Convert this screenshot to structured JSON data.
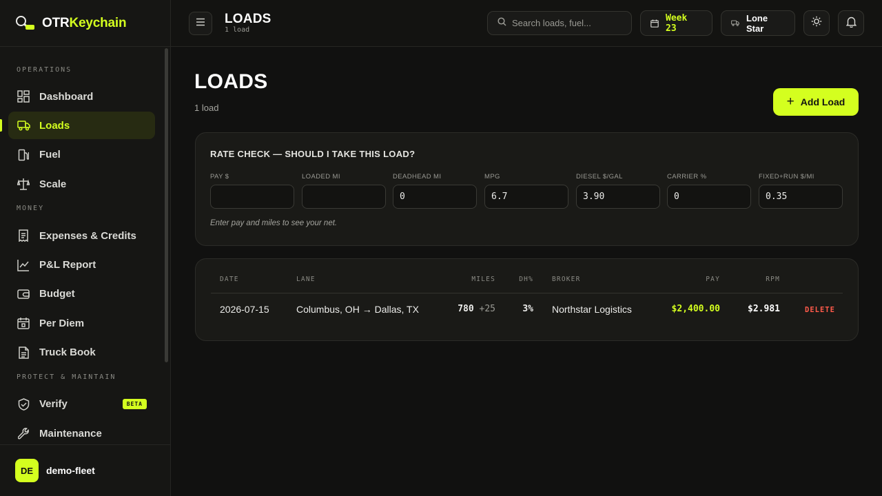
{
  "brand": {
    "part1": "OTR",
    "part2": "Keychain"
  },
  "sidebar": {
    "sections": {
      "operations": "OPERATIONS",
      "money": "MONEY",
      "protect": "PROTECT & MAINTAIN"
    },
    "items": [
      {
        "label": "Dashboard",
        "icon": "dashboard-icon"
      },
      {
        "label": "Loads",
        "icon": "truck-icon",
        "active": true
      },
      {
        "label": "Fuel",
        "icon": "fuel-pump-icon"
      },
      {
        "label": "Scale",
        "icon": "scale-icon"
      },
      {
        "label": "Expenses & Credits",
        "icon": "receipt-icon"
      },
      {
        "label": "P&L Report",
        "icon": "line-chart-icon"
      },
      {
        "label": "Budget",
        "icon": "wallet-icon"
      },
      {
        "label": "Per Diem",
        "icon": "calendar-icon"
      },
      {
        "label": "Truck Book",
        "icon": "document-icon"
      },
      {
        "label": "Verify",
        "icon": "shield-check-icon",
        "badge": "BETA"
      },
      {
        "label": "Maintenance",
        "icon": "wrench-icon"
      }
    ]
  },
  "user": {
    "initials": "DE",
    "name": "demo-fleet"
  },
  "topbar": {
    "title": "LOADS",
    "subtitle": "1 load",
    "search_placeholder": "Search loads, fuel...",
    "week": "Week 23",
    "company": "Lone Star"
  },
  "page": {
    "title": "LOADS",
    "subtitle": "1 load",
    "add_button": "Add Load"
  },
  "rate_check": {
    "title": "RATE CHECK — SHOULD I TAKE THIS LOAD?",
    "fields": [
      {
        "label": "PAY $",
        "value": ""
      },
      {
        "label": "LOADED MI",
        "value": ""
      },
      {
        "label": "DEADHEAD MI",
        "value": "0"
      },
      {
        "label": "MPG",
        "value": "6.7"
      },
      {
        "label": "DIESEL $/GAL",
        "value": "3.90"
      },
      {
        "label": "CARRIER %",
        "value": "0"
      },
      {
        "label": "FIXED+RUN $/MI",
        "value": "0.35"
      }
    ],
    "hint": "Enter pay and miles to see your net."
  },
  "loads_table": {
    "headers": {
      "date": "DATE",
      "lane": "LANE",
      "miles": "MILES",
      "dh": "DH%",
      "broker": "BROKER",
      "pay": "PAY",
      "rpm": "RPM"
    },
    "rows": [
      {
        "date": "2026-07-15",
        "lane": "Columbus, OH → Dallas, TX",
        "miles": "780",
        "deadhead": "+25",
        "dh": "3%",
        "broker": "Northstar Logistics",
        "pay": "$2,400.00",
        "rpm": "$2.981",
        "action": "DELETE"
      }
    ]
  },
  "colors": {
    "accent": "#d4ff1f",
    "danger": "#ff5a4a",
    "background": "#111110"
  }
}
